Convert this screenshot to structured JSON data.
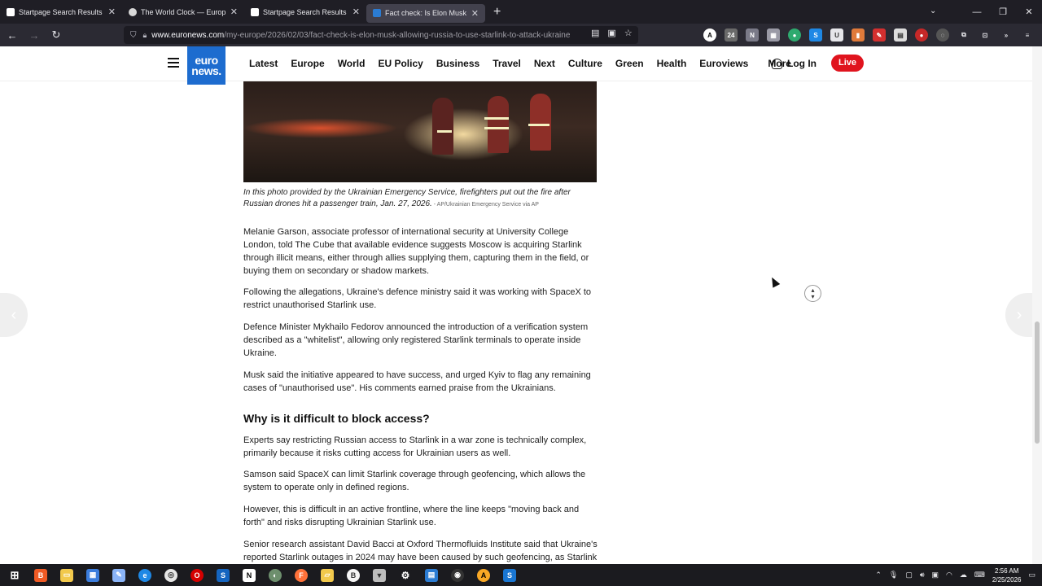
{
  "browser": {
    "tabs": [
      {
        "title": "Startpage Search Results",
        "favicon": "startpage-icon",
        "active": false
      },
      {
        "title": "The World Clock — Europe",
        "favicon": "world-clock-icon",
        "active": false
      },
      {
        "title": "Startpage Search Results",
        "favicon": "startpage-icon",
        "active": false
      },
      {
        "title": "Fact check: Is Elon Musk allowin",
        "favicon": "euronews-icon",
        "active": true
      }
    ],
    "url_domain": "www.euronews.com",
    "url_path": "/my-europe/2026/02/03/fact-check-is-elon-musk-allowing-russia-to-use-starlink-to-attack-ukraine"
  },
  "site": {
    "logo_line1": "euro",
    "logo_line2": "news.",
    "nav": [
      "Latest",
      "Europe",
      "World",
      "EU Policy",
      "Business",
      "Travel",
      "Next",
      "Culture",
      "Green",
      "Health",
      "Euroviews",
      "More"
    ],
    "login_label": "Log In",
    "live_label": "Live"
  },
  "article": {
    "caption": "In this photo provided by the Ukrainian Emergency Service, firefighters put out the fire after Russian drones hit a passenger train, Jan. 27, 2026.",
    "caption_credit": " - AP/Ukrainian Emergency Service via AP",
    "paragraphs": [
      "Melanie Garson, associate professor of international security at University College London, told The Cube that available evidence suggests Moscow is acquiring Starlink through illicit means, either through allies supplying them, capturing them in the field, or buying them on secondary or shadow markets.",
      "Following the allegations, Ukraine's defence ministry said it was working with SpaceX to restrict unauthorised Starlink use.",
      "Defence Minister Mykhailo Fedorov announced the introduction of a verification system described as a \"whitelist\", allowing only registered Starlink terminals to operate inside Ukraine.",
      "Musk said the initiative appeared to have success, and urged Kyiv to flag any remaining cases of \"unauthorised use\". His comments earned praise from the Ukrainians."
    ],
    "heading": "Why is it difficult to block access?",
    "paragraphs2": [
      "Experts say restricting Russian access to Starlink in a war zone is technically complex, primarily because it risks cutting access for Ukrainian users as well.",
      "Samson said SpaceX can limit Starlink coverage through geofencing, which allows the system to operate only in defined regions.",
      "However, this is difficult in an active frontline, where the line keeps \"moving back and forth\" and risks disrupting Ukrainian Starlink use.",
      "Senior research assistant David Bacci at Oxford Thermofluids Institute said that Ukraine's reported Starlink outages in 2024 may have been caused by such geofencing, as Starlink"
    ]
  },
  "taskbar": {
    "time": "2:56 AM",
    "date": "2/25/2026"
  },
  "colors": {
    "euronews_blue": "#1d6ccf",
    "live_red": "#e0141e",
    "tab_bar": "#1f1e25"
  }
}
